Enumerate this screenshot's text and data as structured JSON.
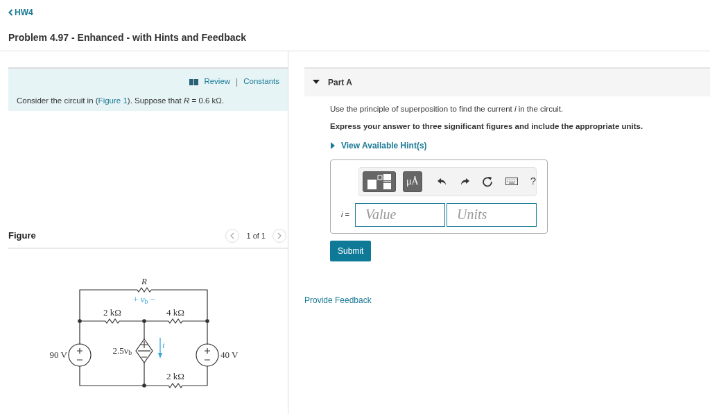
{
  "back_link": "HW4",
  "title": "Problem 4.97 - Enhanced - with Hints and Feedback",
  "intro": {
    "links": [
      {
        "label": "Review",
        "kind": "review"
      },
      {
        "label": "Constants",
        "kind": "plain"
      }
    ],
    "separator": "|",
    "text_before": "Consider the circuit in (",
    "figure_link": "Figure 1",
    "text_after": "). Suppose that *R* = 0.6 kΩ."
  },
  "figure": {
    "heading": "Figure",
    "pager": "1 of 1",
    "labels": [
      "*R*",
      "+ *v*$_{b}$ −",
      "2 kΩ",
      "4 kΩ",
      "90 V",
      "2.5v$_{b}$",
      "*i*",
      "40 V",
      "2 kΩ"
    ]
  },
  "part": {
    "title": "Part A",
    "expanded": true,
    "question": "Use the principle of superposition to find the current *i* in the circuit.",
    "instruction": "Express your answer to three significant figures and include the appropriate units.",
    "hints_link": "View Available Hint(s)",
    "hints_expanded": false,
    "toolbar": [
      {
        "kind": "templates"
      },
      {
        "kind": "units",
        "label": "μÅ"
      },
      {
        "kind": "undo"
      },
      {
        "kind": "redo"
      },
      {
        "kind": "reset"
      },
      {
        "kind": "keyboard"
      },
      {
        "kind": "help",
        "label": "?"
      }
    ],
    "variable": "*i* =",
    "value_placeholder": "Value",
    "units_placeholder": "Units",
    "submit": "Submit"
  },
  "feedback_link": "Provide Feedback"
}
